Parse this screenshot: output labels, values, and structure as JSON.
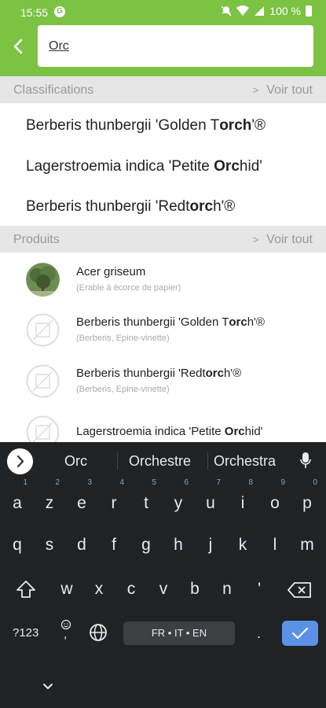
{
  "status": {
    "time": "15:55",
    "battery": "100 %"
  },
  "search": {
    "value": "Orc"
  },
  "classifications": {
    "header": "Classifications",
    "see_all": "Voir tout",
    "items": [
      {
        "pre": "Berberis thunbergii 'Golden T",
        "match": "orch",
        "post": "'®"
      },
      {
        "pre": "Lagerstroemia indica 'Petite ",
        "match": "Orc",
        "post": "hid'"
      },
      {
        "pre": "Berberis thunbergii 'Redt",
        "match": "orc",
        "post": "h'®"
      }
    ]
  },
  "products": {
    "header": "Produits",
    "see_all": "Voir tout",
    "items": [
      {
        "name_pre": "Acer griseum",
        "name_match": "",
        "name_post": "",
        "sub": "(Erable à écorce de papier)"
      },
      {
        "name_pre": "Berberis thunbergii 'Golden T",
        "name_match": "orc",
        "name_post": "h'®",
        "sub": "(Berberis, Epine-vinette)"
      },
      {
        "name_pre": "Berberis thunbergii 'Redt",
        "name_match": "orc",
        "name_post": "h'®",
        "sub": "(Berberis, Epine-vinette)"
      },
      {
        "name_pre": "Lagerstroemia indica 'Petite ",
        "name_match": "Orc",
        "name_post": "hid'",
        "sub": ""
      }
    ]
  },
  "keyboard": {
    "suggestions": [
      "Orc",
      "Orchestre",
      "Orchestra"
    ],
    "row1": [
      "a",
      "z",
      "e",
      "r",
      "t",
      "y",
      "u",
      "i",
      "o",
      "p"
    ],
    "row1_hints": [
      "1",
      "2",
      "3",
      "4",
      "5",
      "6",
      "7",
      "8",
      "9",
      "0"
    ],
    "row2": [
      "q",
      "s",
      "d",
      "f",
      "g",
      "h",
      "j",
      "k",
      "l",
      "m"
    ],
    "row3": [
      "w",
      "x",
      "c",
      "v",
      "b",
      "n",
      "'"
    ],
    "symbols_label": "?123",
    "comma": ",",
    "space_label": "FR • IT • EN",
    "period": "."
  },
  "colors": {
    "accent": "#7cc243",
    "keyboard_bg": "#1f2326",
    "enter": "#5b92e5"
  }
}
